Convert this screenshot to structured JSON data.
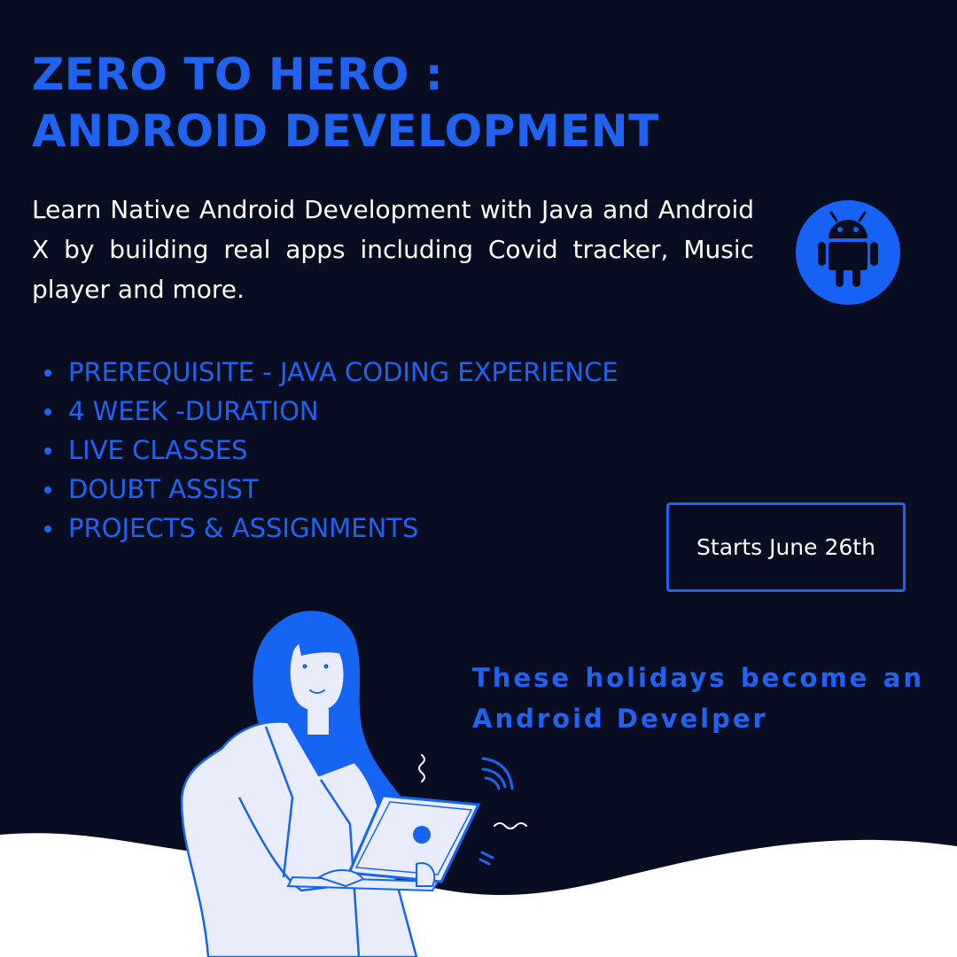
{
  "title": {
    "line1": "ZERO TO HERO :",
    "line2": "ANDROID DEVELOPMENT"
  },
  "intro": "Learn Native Android Development with Java and Android X  by building real apps including Covid tracker, Music player and more.",
  "android_icon": "android-robot-icon",
  "features": [
    "PREREQUISITE - JAVA CODING EXPERIENCE",
    "4 WEEK -DURATION",
    "LIVE CLASSES",
    "DOUBT ASSIST",
    "PROJECTS & ASSIGNMENTS"
  ],
  "start_label": "Starts June 26th",
  "tagline": {
    "line1": "These holidays become an",
    "line2": "Android Develper"
  },
  "colors": {
    "background": "#080d22",
    "accent": "#1f63f0",
    "text": "#ffffff",
    "illustration_light": "#e9edfb"
  }
}
